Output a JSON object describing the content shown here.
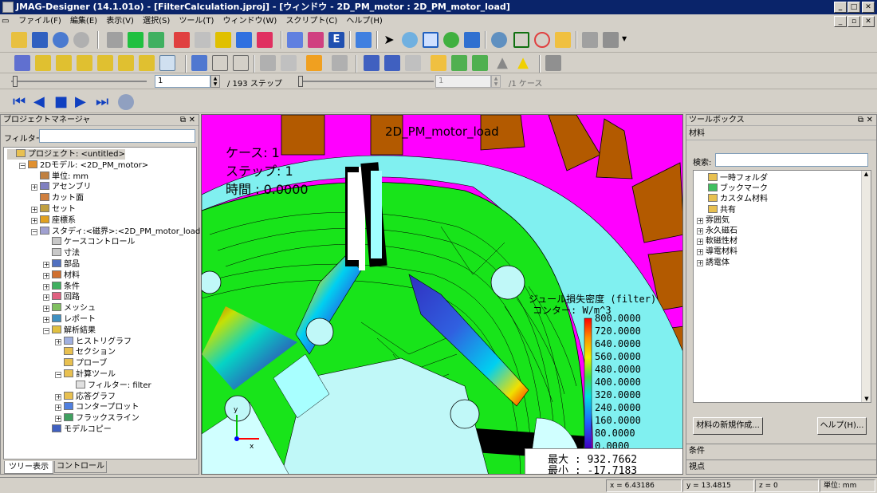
{
  "window": {
    "title": "JMAG-Designer (14.1.01o) - [FilterCalculation.jproj] - [ウィンドウ - 2D_PM_motor : 2D_PM_motor_load]",
    "minimize": "_",
    "restore": "□",
    "close": "✕"
  },
  "menu": [
    "ファイル(F)",
    "編集(E)",
    "表示(V)",
    "選択(S)",
    "ツール(T)",
    "ウィンドウ(W)",
    "スクリプト(C)",
    "ヘルプ(H)"
  ],
  "step": {
    "value": "1",
    "total": "/ 193 ステップ",
    "case_value": "1",
    "case_total": "/1 ケース"
  },
  "project_manager": {
    "title": "プロジェクトマネージャ",
    "filter_label": "フィルター:",
    "filter_value": "",
    "tree": [
      {
        "label": "プロジェクト: <untitled>",
        "indent": 0,
        "expander": "",
        "icon": "folder"
      },
      {
        "label": "2Dモデル: <2D_PM_motor>",
        "indent": 1,
        "expander": "−",
        "icon": "model"
      },
      {
        "label": "単位: mm",
        "indent": 2,
        "expander": "",
        "icon": "unit"
      },
      {
        "label": "アセンブリ",
        "indent": 2,
        "expander": "+",
        "icon": "assembly"
      },
      {
        "label": "カット面",
        "indent": 2,
        "expander": "",
        "icon": "cut"
      },
      {
        "label": "セット",
        "indent": 2,
        "expander": "+",
        "icon": "set"
      },
      {
        "label": "座標系",
        "indent": 2,
        "expander": "+",
        "icon": "coord"
      },
      {
        "label": "スタディ:<磁界>:<2D_PM_motor_load>",
        "indent": 2,
        "expander": "−",
        "icon": "study"
      },
      {
        "label": "ケースコントロール",
        "indent": 3,
        "expander": "",
        "icon": "table"
      },
      {
        "label": "寸法",
        "indent": 3,
        "expander": "",
        "icon": "table"
      },
      {
        "label": "部品",
        "indent": 3,
        "expander": "+",
        "icon": "part"
      },
      {
        "label": "材料",
        "indent": 3,
        "expander": "+",
        "icon": "material"
      },
      {
        "label": "条件",
        "indent": 3,
        "expander": "+",
        "icon": "condition"
      },
      {
        "label": "回路",
        "indent": 3,
        "expander": "+",
        "icon": "circuit"
      },
      {
        "label": "メッシュ",
        "indent": 3,
        "expander": "+",
        "icon": "mesh"
      },
      {
        "label": "レポート",
        "indent": 3,
        "expander": "+",
        "icon": "report"
      },
      {
        "label": "解析結果",
        "indent": 3,
        "expander": "−",
        "icon": "result"
      },
      {
        "label": "ヒストリグラフ",
        "indent": 4,
        "expander": "+",
        "icon": "graph"
      },
      {
        "label": "セクション",
        "indent": 4,
        "expander": "",
        "icon": "folder"
      },
      {
        "label": "プローブ",
        "indent": 4,
        "expander": "",
        "icon": "folder"
      },
      {
        "label": "計算ツール",
        "indent": 4,
        "expander": "−",
        "icon": "folder"
      },
      {
        "label": "フィルター: filter",
        "indent": 5,
        "expander": "",
        "icon": "filter"
      },
      {
        "label": "応答グラフ",
        "indent": 4,
        "expander": "+",
        "icon": "folder"
      },
      {
        "label": "コンタープロット",
        "indent": 4,
        "expander": "+",
        "icon": "contour"
      },
      {
        "label": "フラックスライン",
        "indent": 4,
        "expander": "+",
        "icon": "flux"
      },
      {
        "label": "モデルコピー",
        "indent": 3,
        "expander": "",
        "icon": "copy"
      }
    ],
    "tabs": [
      "ツリー表示",
      "コントロール"
    ]
  },
  "viewport": {
    "title": "2D_PM_motor_load",
    "case": "ケース: 1",
    "step": "ステップ: 1",
    "time": "時間 : 0.0000",
    "legend_title": "ジュール損失密度 (filter)",
    "legend_unit": "コンター: W/m^3",
    "legend_values": [
      "800.0000",
      "720.0000",
      "640.0000",
      "560.0000",
      "480.0000",
      "400.0000",
      "320.0000",
      "240.0000",
      "160.0000",
      "80.0000",
      "0.0000"
    ],
    "max": "最大 : 932.7662",
    "min": "最小 : -17.7183",
    "colors": {
      "background": "#18e41a",
      "contour_max": "#ff0000",
      "contour_min": "#2000c0"
    }
  },
  "toolbox": {
    "title": "ツールボックス",
    "category": "材料",
    "search_label": "検索:",
    "search_value": "",
    "items": [
      {
        "label": "一時フォルダ",
        "indent": 1,
        "expander": ""
      },
      {
        "label": "ブックマーク",
        "indent": 1,
        "expander": ""
      },
      {
        "label": "カスタム材料",
        "indent": 1,
        "expander": ""
      },
      {
        "label": "共有",
        "indent": 1,
        "expander": ""
      },
      {
        "label": "雰囲気",
        "indent": 0,
        "expander": "+"
      },
      {
        "label": "永久磁石",
        "indent": 0,
        "expander": "+"
      },
      {
        "label": "軟磁性材",
        "indent": 0,
        "expander": "+"
      },
      {
        "label": "導電材料",
        "indent": 0,
        "expander": "+"
      },
      {
        "label": "誘電体",
        "indent": 0,
        "expander": "+"
      }
    ],
    "new_material_button": "材料の新規作成...",
    "help_button": "ヘルプ(H)...",
    "sections": [
      "条件",
      "視点"
    ]
  },
  "status": {
    "x_label": "x =",
    "x": "6.43186",
    "y_label": "y =",
    "y": "13.4815",
    "z_label": "z =",
    "z": "0",
    "unit": "単位: mm"
  }
}
